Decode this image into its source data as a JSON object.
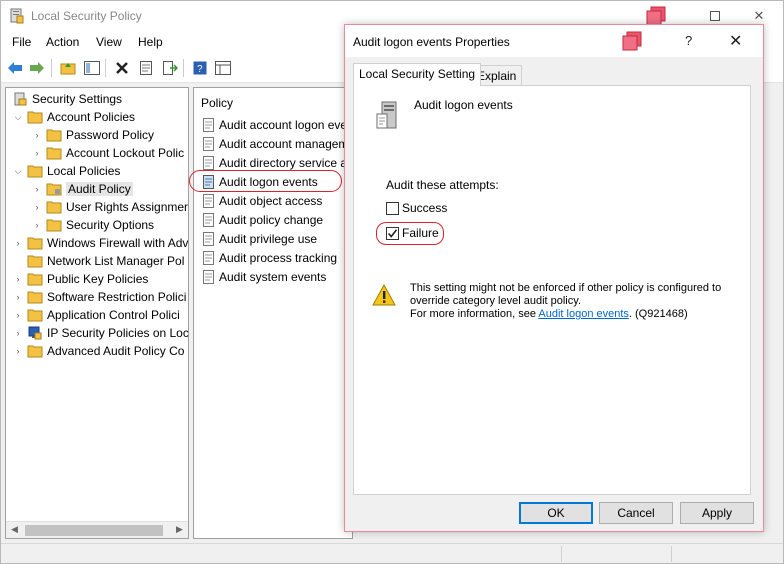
{
  "main_window": {
    "title": "Local Security Policy"
  },
  "menu": [
    {
      "label": "File"
    },
    {
      "label": "Action"
    },
    {
      "label": "View"
    },
    {
      "label": "Help"
    }
  ],
  "tree": {
    "items": [
      {
        "label": "Security Settings"
      },
      {
        "label": "Account Policies"
      },
      {
        "label": "Password Policy"
      },
      {
        "label": "Account Lockout Polic"
      },
      {
        "label": "Local Policies"
      },
      {
        "label": "Audit Policy"
      },
      {
        "label": "User Rights Assignmer"
      },
      {
        "label": "Security Options"
      },
      {
        "label": "Windows Firewall with Adv"
      },
      {
        "label": "Network List Manager Pol"
      },
      {
        "label": "Public Key Policies"
      },
      {
        "label": "Software Restriction Polici"
      },
      {
        "label": "Application Control Polici"
      },
      {
        "label": "IP Security Policies on Loc"
      },
      {
        "label": "Advanced Audit Policy Co"
      }
    ]
  },
  "policy_list": {
    "header": "Policy",
    "items": [
      {
        "label": "Audit account logon eve"
      },
      {
        "label": "Audit account managem"
      },
      {
        "label": "Audit directory service a"
      },
      {
        "label": "Audit logon events"
      },
      {
        "label": "Audit object access"
      },
      {
        "label": "Audit policy change"
      },
      {
        "label": "Audit privilege use"
      },
      {
        "label": "Audit process tracking"
      },
      {
        "label": "Audit system events"
      }
    ]
  },
  "dialog": {
    "title": "Audit logon events Properties",
    "help": "?",
    "close": "✕",
    "tabs": [
      {
        "label": "Local Security Setting",
        "active": true
      },
      {
        "label": "Explain",
        "active": false
      }
    ],
    "policy_name": "Audit logon events",
    "audit_label": "Audit these attempts:",
    "success": {
      "label": "Success",
      "checked": false
    },
    "failure": {
      "label": "Failure",
      "checked": true
    },
    "warning_line1": "This setting might not be enforced if other policy is configured to",
    "warning_line2": "override category level audit policy.",
    "warning_line3_prefix": "For more information, see",
    "warning_link": "Audit logon events",
    "warning_line3_suffix": ". (Q921468)",
    "buttons": {
      "ok": "OK",
      "cancel": "Cancel",
      "apply": "Apply"
    }
  },
  "colors": {
    "highlight_ring": "#d9232d",
    "link": "#0066cc",
    "dialog_border": "#e98a9c"
  }
}
